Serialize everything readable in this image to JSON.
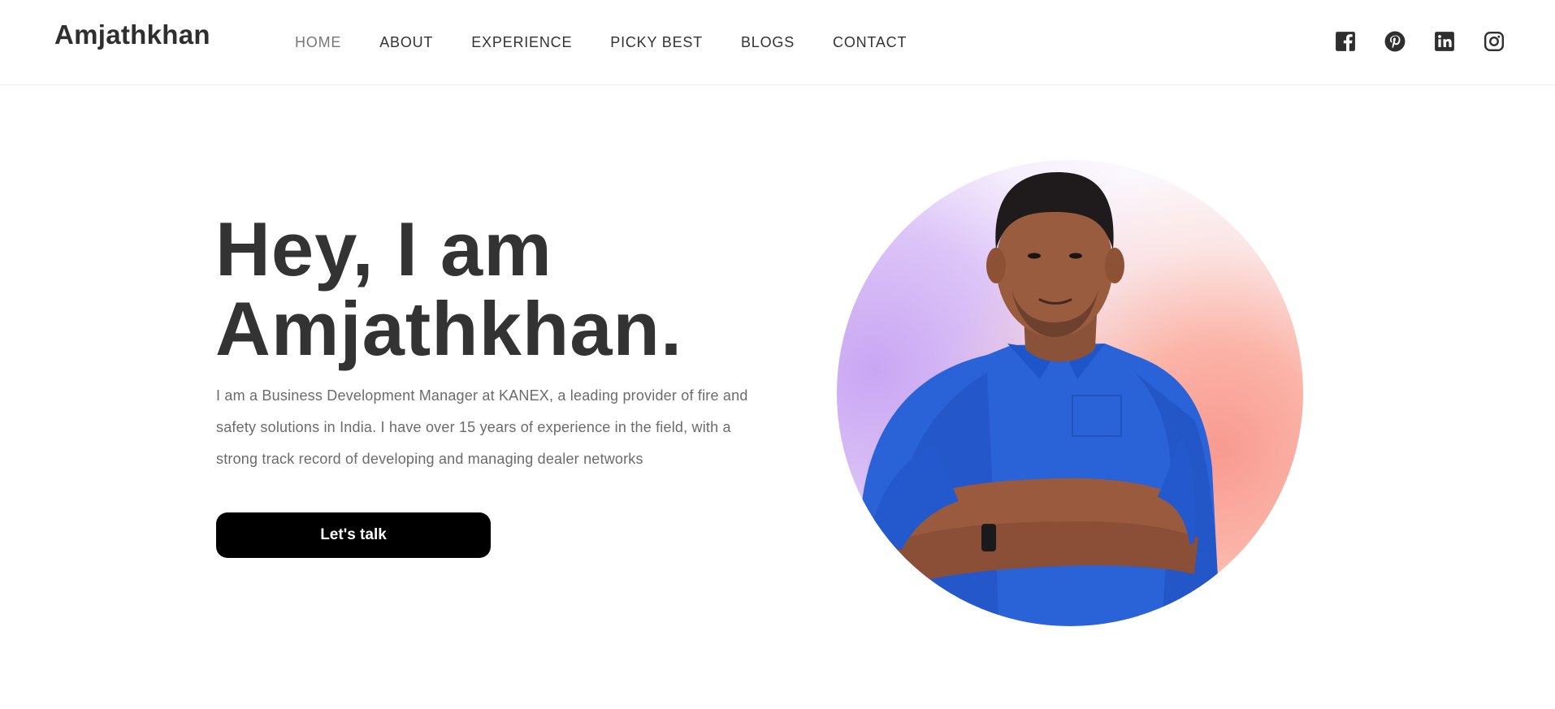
{
  "header": {
    "logo": "Amjathkhan",
    "nav": [
      {
        "label": "HOME",
        "active": true
      },
      {
        "label": "ABOUT",
        "active": false
      },
      {
        "label": "EXPERIENCE",
        "active": false
      },
      {
        "label": "PICKY BEST",
        "active": false
      },
      {
        "label": "BLOGS",
        "active": false
      },
      {
        "label": "CONTACT",
        "active": false
      }
    ],
    "social": [
      {
        "icon": "facebook-icon"
      },
      {
        "icon": "pinterest-icon"
      },
      {
        "icon": "linkedin-icon"
      },
      {
        "icon": "instagram-icon"
      }
    ]
  },
  "hero": {
    "title_line1": "Hey, I am",
    "title_line2": "Amjathkhan.",
    "description": "I am a Business Development Manager at KANEX, a leading provider of fire and safety solutions in India. I have over 15 years of experience in the field, with a strong track record of developing and managing dealer networks",
    "cta_label": "Let's talk",
    "portrait": "profile-photo"
  },
  "colors": {
    "text_dark": "#333333",
    "text_muted": "#6b6b6b",
    "button_bg": "#000000",
    "button_text": "#ffffff",
    "accent_purple": "#c9a6f3",
    "accent_coral": "#f89a90",
    "shirt_blue": "#2a62d8"
  }
}
